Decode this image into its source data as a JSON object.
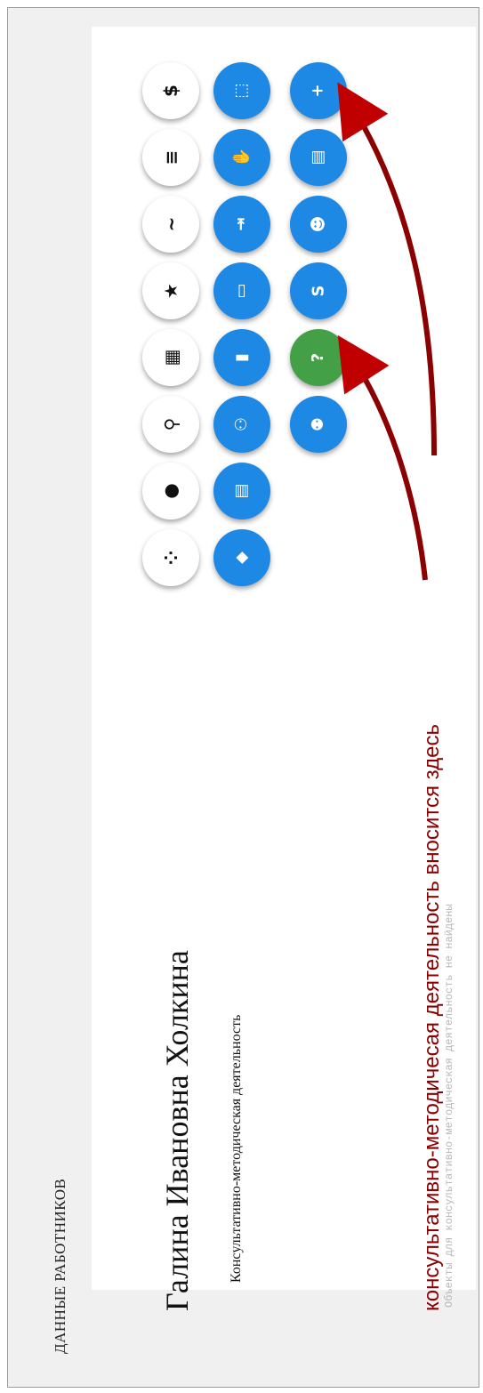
{
  "header": {
    "section_title": "ДАННЫЕ РАБОТНИКОВ"
  },
  "person": {
    "full_name": "Галина Ивановна Холкина",
    "subtitle": "Консультативно-методическая деятельность"
  },
  "annotation": {
    "text": "консультативно-методичесая деятельность вносится здесь"
  },
  "empty_state": {
    "text": "Объекты для консультативно-методическая деятельность не найдены"
  },
  "icons": {
    "white_column": [
      {
        "name": "dollar-icon",
        "glyph": "$"
      },
      {
        "name": "list-icon",
        "glyph": "≡"
      },
      {
        "name": "wave-icon",
        "glyph": "~"
      },
      {
        "name": "star-icon",
        "glyph": "★"
      },
      {
        "name": "calculator-icon",
        "glyph": "▦"
      },
      {
        "name": "person-icon",
        "glyph": "⚲"
      },
      {
        "name": "user-icon",
        "glyph": "●"
      },
      {
        "name": "group-icon",
        "glyph": "⁘"
      }
    ],
    "blue_column": [
      {
        "name": "tag-icon",
        "glyph": "⬚"
      },
      {
        "name": "thumbs-icon",
        "glyph": "✋"
      },
      {
        "name": "sign-in-icon",
        "glyph": "⇥"
      },
      {
        "name": "card-icon",
        "glyph": "▭"
      },
      {
        "name": "document-icon",
        "glyph": "▮"
      },
      {
        "name": "people-icon",
        "glyph": "⚇"
      },
      {
        "name": "book-icon",
        "glyph": "▤"
      },
      {
        "name": "diamond-icon",
        "glyph": "◆"
      }
    ],
    "third_column": [
      {
        "name": "plus-icon",
        "glyph": "+"
      },
      {
        "name": "book-add-icon",
        "glyph": "▤"
      },
      {
        "name": "face-icon",
        "glyph": "☻"
      },
      {
        "name": "s-letter-icon",
        "glyph": "S"
      },
      {
        "name": "question-icon",
        "glyph": "?"
      },
      {
        "name": "add-user-icon",
        "glyph": "⚉"
      }
    ]
  },
  "colors": {
    "blue": "#1e88e5",
    "green": "#43a047",
    "annotation": "#8b0000",
    "arrow": "#8b0000"
  }
}
